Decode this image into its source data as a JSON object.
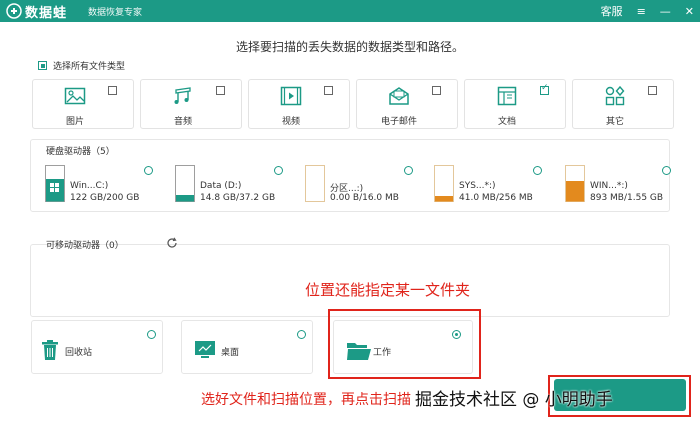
{
  "app": {
    "name": "数据蛙",
    "subtitle": "数据恢复专家",
    "service_label": "客服",
    "menu_glyph": "≡",
    "minimize_glyph": "—",
    "close_glyph": "✕",
    "brand_color": "#1c9a86"
  },
  "instruction": "选择要扫描的丢失数据的数据类型和路径。",
  "select_all_label": "选择所有文件类型",
  "file_types": [
    {
      "label": "图片",
      "icon": "image-icon",
      "checked": false
    },
    {
      "label": "音频",
      "icon": "music-icon",
      "checked": false
    },
    {
      "label": "视频",
      "icon": "video-icon",
      "checked": false
    },
    {
      "label": "电子邮件",
      "icon": "email-icon",
      "checked": false
    },
    {
      "label": "文档",
      "icon": "document-icon",
      "checked": true
    },
    {
      "label": "其它",
      "icon": "other-icon",
      "checked": false
    }
  ],
  "hard_drives": {
    "title": "硬盘驱动器（5）",
    "items": [
      {
        "name": "Win...C:)",
        "size": "122 GB/200 GB",
        "used_fraction": 0.61,
        "fill": "#1c9a86"
      },
      {
        "name": "Data (D:)",
        "size": "14.8 GB/37.2 GB",
        "used_fraction": 0.4,
        "fill": "#ffffff"
      },
      {
        "name": "分区...:)",
        "size": "0.00  B/16.0 MB",
        "used_fraction": 0,
        "fill": "#ffffff"
      },
      {
        "name": "SYS...*:)",
        "size": "41.0 MB/256 MB",
        "used_fraction": 0.16,
        "fill": "#e38a1e"
      },
      {
        "name": "WIN...*:)",
        "size": "893 MB/1.55 GB",
        "used_fraction": 0.58,
        "fill": "#e38a1e"
      }
    ]
  },
  "removable": {
    "title": "可移动驱动器（0）",
    "refresh_icon": "refresh-icon"
  },
  "locations": [
    {
      "label": "回收站",
      "icon": "recycle-bin-icon",
      "selected": false
    },
    {
      "label": "桌面",
      "icon": "desktop-icon",
      "selected": false
    },
    {
      "label": "工作",
      "icon": "folder-icon",
      "selected": true
    }
  ],
  "annotations": {
    "folder_note": "位置还能指定某一文件夹",
    "bottom_note": "选好文件和扫描位置，再点击扫描",
    "watermark": "掘金技术社区 @ 小明助手",
    "color": "#e0241b"
  }
}
